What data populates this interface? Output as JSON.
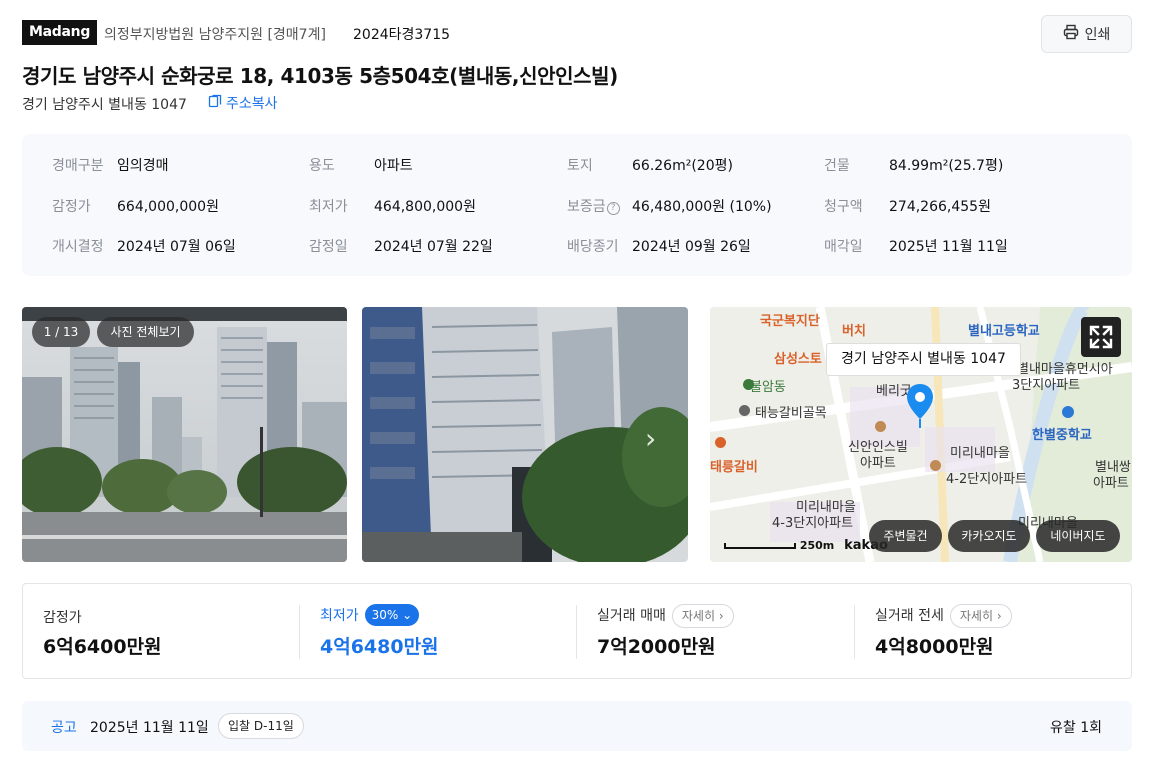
{
  "header": {
    "logo": "Madang",
    "court": "의정부지방법원 남양주지원 [경매7계]",
    "case_no": "2024타경3715",
    "print_label": "인쇄",
    "title": "경기도 남양주시 순화궁로 18, 4103동 5층504호(별내동,신안인스빌)",
    "address": "경기 남양주시 별내동 1047",
    "copy_label": "주소복사"
  },
  "info": {
    "rows": [
      [
        {
          "label": "경매구분",
          "value": "임의경매"
        },
        {
          "label": "용도",
          "value": "아파트"
        },
        {
          "label": "토지",
          "value": "66.26m²(20평)"
        },
        {
          "label": "건물",
          "value": "84.99m²(25.7평)"
        }
      ],
      [
        {
          "label": "감정가",
          "value": "664,000,000원"
        },
        {
          "label": "최저가",
          "value": "464,800,000원"
        },
        {
          "label": "보증금",
          "value": "46,480,000원 (10%)"
        },
        {
          "label": "청구액",
          "value": "274,266,455원"
        }
      ],
      [
        {
          "label": "개시결정",
          "value": "2024년 07월 06일"
        },
        {
          "label": "감정일",
          "value": "2024년 07월 22일"
        },
        {
          "label": "배당종기",
          "value": "2024년 09월 26일"
        },
        {
          "label": "매각일",
          "value": "2025년 11월 11일"
        }
      ]
    ],
    "help_glyph": "?"
  },
  "photos": {
    "counter": "1 / 13",
    "view_all": "사진 전체보기",
    "next_glyph": "›"
  },
  "map": {
    "label": "경기 남양주시 별내동 1047",
    "scale": "250m",
    "brand": "kakao",
    "places": [
      "국군복지단",
      "버치",
      "별내고등학교",
      "삼성스토",
      "별내마을휴먼시아",
      "3단지아파트",
      "불암동",
      "베리굿",
      "태능갈비골목",
      "한별중학교",
      "신안인스빌",
      "아파트",
      "태릉갈비",
      "미리내마을",
      "4-2단지아파트",
      "별내쌍",
      "아파트",
      "미리내마을",
      "4-3단지아파트",
      "미리내마을"
    ],
    "buttons": [
      "주변물건",
      "카카오지도",
      "네이버지도"
    ]
  },
  "prices": {
    "appraisal": {
      "label": "감정가",
      "value": "6억6400만원"
    },
    "minimum": {
      "label": "최저가",
      "badge": "30%",
      "value": "4억6480만원"
    },
    "sale": {
      "label": "실거래 매매",
      "detail": "자세히",
      "value": "7억2000만원"
    },
    "lease": {
      "label": "실거래 전세",
      "detail": "자세히",
      "value": "4억8000만원"
    }
  },
  "notice": {
    "label": "공고",
    "date": "2025년 11월 11일",
    "dday": "입찰 D-11일",
    "fail_count": "유찰 1회"
  },
  "colors": {
    "accent": "#1a73e8",
    "text": "#111111",
    "muted": "#8a8f98"
  }
}
